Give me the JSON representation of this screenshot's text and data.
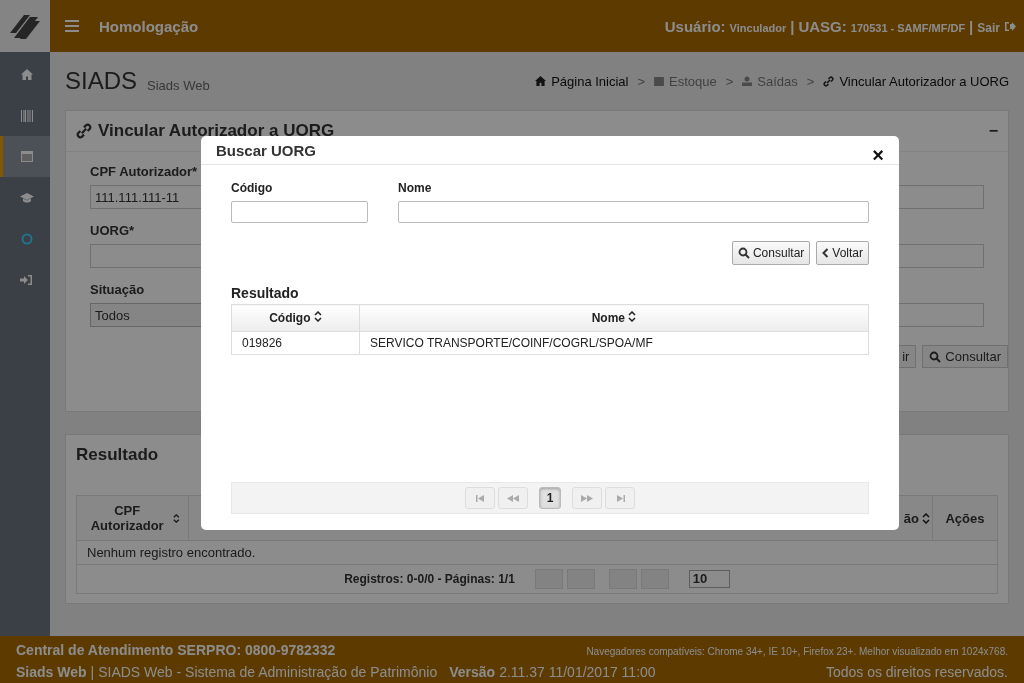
{
  "header": {
    "environment": "Homologação",
    "user_label": "Usuário:",
    "user": "Vinculador",
    "separator_1": "|",
    "uasg_label": "UASG:",
    "uasg": "170531 - SAMF/MF/DF",
    "separator_2": "|",
    "logout": "Sair"
  },
  "sidebar": {
    "items": [
      {
        "selected": false
      },
      {
        "selected": false
      },
      {
        "selected": true
      },
      {
        "selected": false
      },
      {
        "selected": false
      },
      {
        "selected": false
      }
    ]
  },
  "page": {
    "title": "SIADS",
    "subtitle": "Siads Web"
  },
  "breadcrumb": [
    {
      "label": "Página Inicial"
    },
    {
      "label": "Estoque"
    },
    {
      "label": "Saídas"
    },
    {
      "label": "Vincular Autorizador a UORG"
    }
  ],
  "breadcrumb_separator": ">",
  "form_panel": {
    "title": "Vincular Autorizador a UORG",
    "collapse": "−",
    "fields": [
      {
        "label": "CPF Autorizador*",
        "value": "111.111.111-11",
        "kind": "input"
      },
      {
        "label": "UORG*",
        "kind": "input"
      },
      {
        "label": "Situação",
        "value": "Todos",
        "kind": "select"
      }
    ],
    "buttons": [
      {
        "label": "ir",
        "kind": "plain"
      },
      {
        "label": "Consultar",
        "kind": "search"
      }
    ]
  },
  "result_panel": {
    "title": "Resultado",
    "columns": [
      {
        "label": "CPF Autorizador"
      },
      {
        "label": "ão"
      },
      {
        "label": "Ações"
      }
    ],
    "empty": "Nenhum registro encontrado.",
    "records": "Registros: 0-0/0 - Páginas: 1/1",
    "page_size": "10"
  },
  "footer": {
    "support": "Central de Atendimento SERPRO: 0800-9782332",
    "browsers": "Navegadores compatíveis: Chrome 34+, IE 10+, Firefox 23+. Melhor visualizado em 1024x768.",
    "app": "Siads Web",
    "separator": "|",
    "system": "SIADS Web - Sistema de Administração de Patrimônio",
    "version_label": "Versão",
    "version": "2.11.37 11/01/2017 11:00",
    "rights": "Todos os direitos reservados."
  },
  "modal": {
    "title": "Buscar UORG",
    "close": "×",
    "fields": [
      {
        "label": "Código"
      },
      {
        "label": "Nome"
      }
    ],
    "buttons": [
      {
        "label": "Consultar",
        "kind": "search"
      },
      {
        "label": "Voltar",
        "kind": "back"
      }
    ],
    "result_title": "Resultado",
    "columns": [
      "Código",
      "Nome"
    ],
    "rows": [
      [
        "019826",
        "SERVICO TRANSPORTE/COINF/COGRL/SPOA/MF"
      ]
    ],
    "pages": [
      {
        "label": "1",
        "selected": true
      }
    ]
  }
}
